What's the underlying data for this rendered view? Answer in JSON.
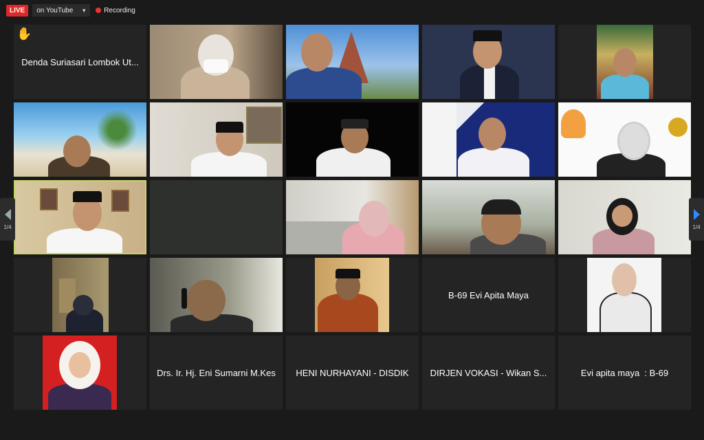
{
  "topbar": {
    "live_label": "LIVE",
    "stream_target": "on YouTube",
    "recording_label": "Recording"
  },
  "participants": {
    "p1_name": "Denda Suriasari Lombok Ut...",
    "p19_name": "B-69 Evi Apita Maya",
    "p22_name": "Drs. Ir. Hj. Eni Sumarni M.Kes",
    "p23_name": "HENI NURHAYANI - DISDIK",
    "p24_name": "DIRJEN VOKASI - Wikan S...",
    "p25_name": "Evi apita maya  : B-69"
  },
  "pagination": {
    "left": "1/4",
    "right": "1/4"
  },
  "colors": {
    "live_red": "#e02828",
    "active_speaker_border": "#c8d26a",
    "next_arrow": "#2d8cff"
  }
}
